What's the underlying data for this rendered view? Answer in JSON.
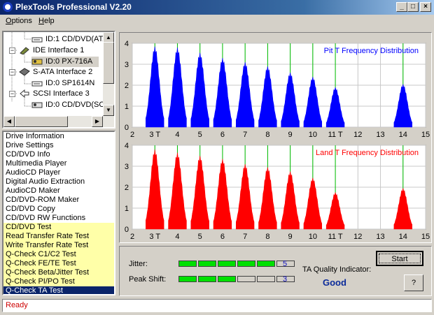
{
  "window": {
    "title": "PlexTools Professional V2.20",
    "controls": {
      "minimize": "_",
      "maximize": "□",
      "close": "×"
    }
  },
  "menu": [
    {
      "pre": "",
      "ul": "O",
      "post": "ptions"
    },
    {
      "pre": "",
      "ul": "H",
      "post": "elp"
    }
  ],
  "tree": {
    "nodes": [
      {
        "label": "ID:1  CD/DVD(ATA",
        "icon": "drive-icon"
      },
      {
        "label": "IDE Interface 1",
        "icon": "ide-card-icon"
      },
      {
        "label": "ID:0  PX-716A",
        "icon": "drive-icon"
      },
      {
        "label": "S-ATA Interface 2",
        "icon": "sata-card-icon"
      },
      {
        "label": "ID:0  SP1614N",
        "icon": "harddisk-icon"
      },
      {
        "label": "SCSI Interface 3",
        "icon": "scsi-icon"
      },
      {
        "label": "ID:0  CD/DVD(SC",
        "icon": "drive-icon"
      }
    ]
  },
  "functions": [
    {
      "label": "Drive Information",
      "state": "normal"
    },
    {
      "label": "Drive Settings",
      "state": "normal"
    },
    {
      "label": "CD/DVD Info",
      "state": "normal"
    },
    {
      "label": "Multimedia Player",
      "state": "normal"
    },
    {
      "label": "AudioCD Player",
      "state": "normal"
    },
    {
      "label": "Digital Audio Extraction",
      "state": "normal"
    },
    {
      "label": "AudioCD Maker",
      "state": "normal"
    },
    {
      "label": "CD/DVD-ROM Maker",
      "state": "normal"
    },
    {
      "label": "CD/DVD Copy",
      "state": "normal"
    },
    {
      "label": "CD/DVD RW Functions",
      "state": "normal"
    },
    {
      "label": "CD/DVD Test",
      "state": "highlight"
    },
    {
      "label": "Read Transfer Rate Test",
      "state": "highlight"
    },
    {
      "label": "Write Transfer Rate Test",
      "state": "highlight"
    },
    {
      "label": "Q-Check C1/C2 Test",
      "state": "highlight"
    },
    {
      "label": "Q-Check FE/TE Test",
      "state": "highlight"
    },
    {
      "label": "Q-Check Beta/Jitter Test",
      "state": "highlight"
    },
    {
      "label": "Q-Check PI/PO Test",
      "state": "highlight"
    },
    {
      "label": "Q-Check TA Test",
      "state": "selected"
    }
  ],
  "chart_data": [
    {
      "type": "area",
      "title": "Pit T Frequency Distribution",
      "color": "#0000ff",
      "xlim": [
        2,
        15
      ],
      "ylim": [
        0,
        4
      ],
      "xticks": [
        "2",
        "3 T",
        "4",
        "5",
        "6",
        "7",
        "8",
        "9",
        "10",
        "11 T",
        "12",
        "13",
        "14",
        "15"
      ],
      "yticks": [
        0,
        1,
        2,
        3,
        4
      ],
      "marker_lines_x": [
        3,
        4,
        5,
        6,
        7,
        8,
        9,
        10,
        11,
        14
      ],
      "peaks": [
        {
          "x": 3,
          "y": 3.85
        },
        {
          "x": 4,
          "y": 3.8
        },
        {
          "x": 5,
          "y": 3.55
        },
        {
          "x": 6,
          "y": 3.3
        },
        {
          "x": 7,
          "y": 3.1
        },
        {
          "x": 8,
          "y": 2.9
        },
        {
          "x": 9,
          "y": 2.6
        },
        {
          "x": 10,
          "y": 2.4
        },
        {
          "x": 11,
          "y": 1.9
        },
        {
          "x": 14,
          "y": 2.05
        }
      ]
    },
    {
      "type": "area",
      "title": "Land T Frequency Distribution",
      "color": "#ff0000",
      "xlim": [
        2,
        15
      ],
      "ylim": [
        0,
        4
      ],
      "xticks": [
        "2",
        "3 T",
        "4",
        "5",
        "6",
        "7",
        "8",
        "9",
        "10",
        "11 T",
        "12",
        "13",
        "14",
        "15"
      ],
      "yticks": [
        0,
        1,
        2,
        3,
        4
      ],
      "marker_lines_x": [
        3,
        4,
        5,
        6,
        7,
        8,
        9,
        10,
        11,
        14
      ],
      "peaks": [
        {
          "x": 3,
          "y": 3.8
        },
        {
          "x": 4,
          "y": 3.65
        },
        {
          "x": 5,
          "y": 3.5
        },
        {
          "x": 6,
          "y": 3.35
        },
        {
          "x": 7,
          "y": 3.1
        },
        {
          "x": 8,
          "y": 2.95
        },
        {
          "x": 9,
          "y": 2.75
        },
        {
          "x": 10,
          "y": 2.45
        },
        {
          "x": 11,
          "y": 1.75
        },
        {
          "x": 14,
          "y": 1.95
        }
      ]
    }
  ],
  "quality": {
    "jitter_label": "Jitter:",
    "jitter_value": "5",
    "jitter_leds_total": 6,
    "peak_label": "Peak Shift:",
    "peak_value": "3",
    "peak_leds_total": 6,
    "ta_label": "TA Quality Indicator:",
    "ta_value": "Good",
    "start_label": "Start",
    "help_label": "?"
  },
  "status": "Ready"
}
